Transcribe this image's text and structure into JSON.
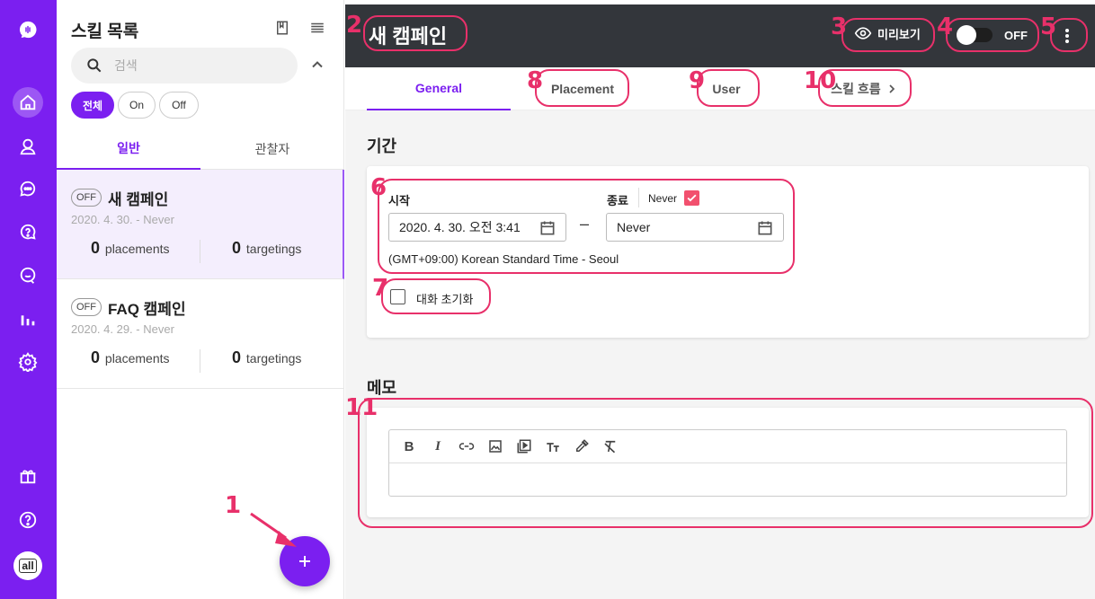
{
  "sidebar_rail": {
    "items": [
      "logo",
      "home",
      "user",
      "chat",
      "help",
      "talk",
      "stats",
      "settings",
      "gift",
      "question",
      "profile"
    ],
    "avatar_label": "all"
  },
  "skill_panel": {
    "title": "스킬 목록",
    "search_placeholder": "검색",
    "filters": [
      "전체",
      "On",
      "Off"
    ],
    "tabs": [
      "일반",
      "관찰자"
    ],
    "campaigns": [
      {
        "status": "OFF",
        "name": "새 캠페인",
        "dates": "2020. 4. 30. - Never",
        "placements": "0",
        "placements_label": "placements",
        "targetings": "0",
        "targetings_label": "targetings"
      },
      {
        "status": "OFF",
        "name": "FAQ 캠페인",
        "dates": "2020. 4. 29. - Never",
        "placements": "0",
        "placements_label": "placements",
        "targetings": "0",
        "targetings_label": "targetings"
      }
    ]
  },
  "header": {
    "title": "새 캠페인",
    "preview_label": "미리보기",
    "toggle_label": "OFF"
  },
  "tabs": [
    "General",
    "Placement",
    "User",
    "스킬 흐름"
  ],
  "period": {
    "section_title": "기간",
    "start_label": "시작",
    "start_value": "2020. 4. 30. 오전 3:41",
    "separator": "–",
    "end_label": "종료",
    "never_label": "Never",
    "end_value": "Never",
    "timezone": "(GMT+09:00) Korean Standard Time - Seoul",
    "reset_label": "대화 초기화"
  },
  "memo": {
    "section_title": "메모",
    "toolbar": [
      "B",
      "I",
      "link",
      "image",
      "video",
      "text-size",
      "color-picker",
      "clear-format"
    ]
  },
  "annotations": [
    "1",
    "2",
    "3",
    "4",
    "5",
    "6",
    "7",
    "8",
    "9",
    "10",
    "11"
  ],
  "colors": {
    "primary": "#7b1ff0",
    "header": "#33363b",
    "annotation": "#e8306a",
    "checkbox": "#f2506e"
  }
}
